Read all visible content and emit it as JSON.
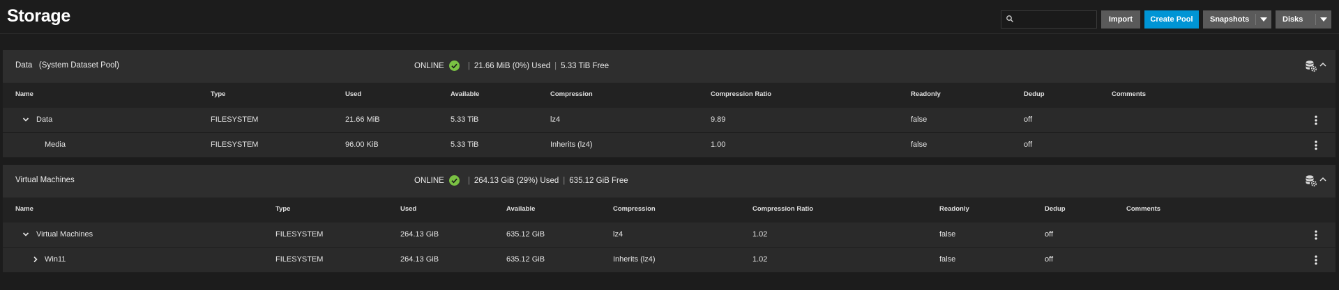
{
  "header": {
    "title": "Storage",
    "search": {
      "value": "",
      "placeholder": ""
    },
    "buttons": {
      "import": "Import",
      "create_pool": "Create Pool",
      "snapshots": "Snapshots",
      "disks": "Disks"
    }
  },
  "colors": {
    "accent": "#0095d5",
    "online": "#7ac143",
    "background": "#1c1c1c",
    "panel": "#2a2a2a"
  },
  "icons": [
    "search-icon",
    "chevron-down-icon",
    "check-circle-icon",
    "database-gear-icon",
    "chevron-up-icon",
    "more-vert-icon",
    "chevron-right-icon"
  ],
  "columns": [
    "Name",
    "Type",
    "Used",
    "Available",
    "Compression",
    "Compression Ratio",
    "Readonly",
    "Dedup",
    "Comments"
  ],
  "pools": [
    {
      "name": "Data",
      "tag": "(System Dataset Pool)",
      "status": "ONLINE",
      "used": "21.66 MiB (0%) Used",
      "free": "5.33 TiB Free",
      "rows": [
        {
          "name": "Data",
          "type": "FILESYSTEM",
          "used": "21.66 MiB",
          "available": "5.33 TiB",
          "compression": "lz4",
          "ratio": "9.89",
          "readonly": "false",
          "dedup": "off",
          "comments": ""
        },
        {
          "name": "Media",
          "type": "FILESYSTEM",
          "used": "96.00 KiB",
          "available": "5.33 TiB",
          "compression": "Inherits (lz4)",
          "ratio": "1.00",
          "readonly": "false",
          "dedup": "off",
          "comments": ""
        }
      ]
    },
    {
      "name": "Virtual Machines",
      "tag": "",
      "status": "ONLINE",
      "used": "264.13 GiB (29%) Used",
      "free": "635.12 GiB Free",
      "rows": [
        {
          "name": "Virtual Machines",
          "type": "FILESYSTEM",
          "used": "264.13 GiB",
          "available": "635.12 GiB",
          "compression": "lz4",
          "ratio": "1.02",
          "readonly": "false",
          "dedup": "off",
          "comments": ""
        },
        {
          "name": "Win11",
          "type": "FILESYSTEM",
          "used": "264.13 GiB",
          "available": "635.12 GiB",
          "compression": "Inherits (lz4)",
          "ratio": "1.02",
          "readonly": "false",
          "dedup": "off",
          "comments": ""
        }
      ]
    }
  ]
}
